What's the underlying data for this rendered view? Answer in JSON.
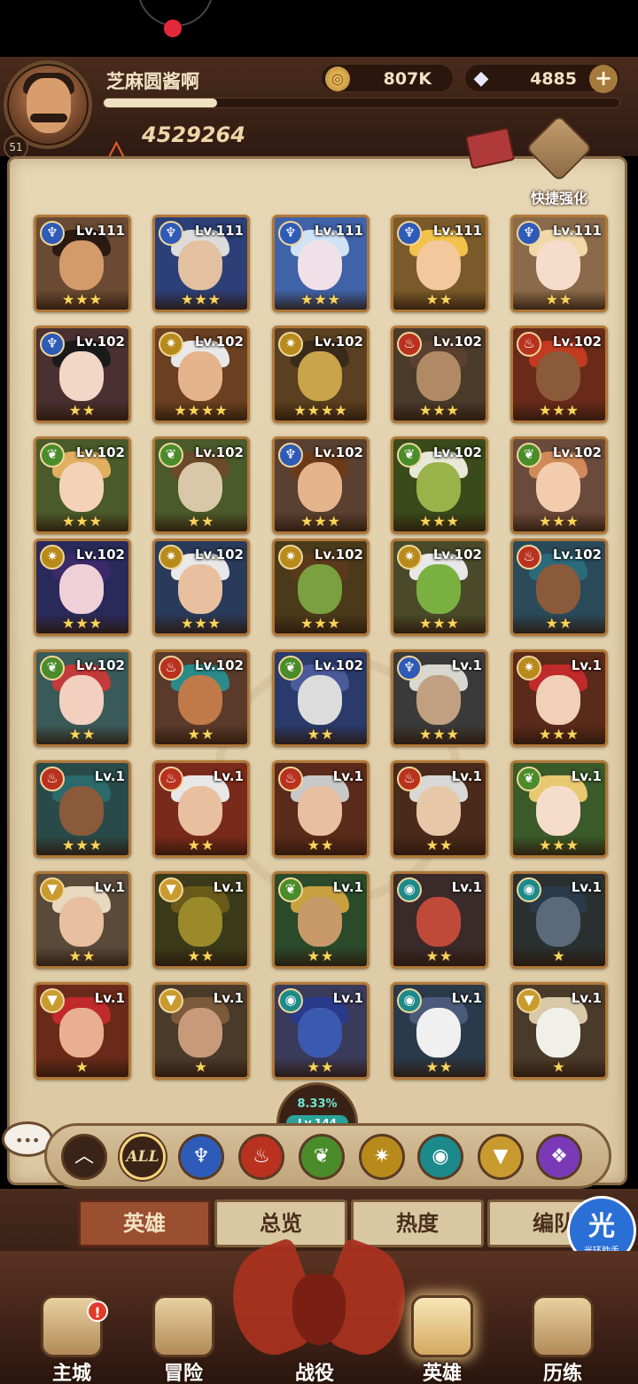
{
  "player": {
    "name": "芝麻圆酱啊",
    "level": "51",
    "power": "4529264",
    "exp_fraction": 0.22
  },
  "currency": {
    "gold": "807K",
    "gems": "4885",
    "plus_label": "+"
  },
  "quick_enhance": {
    "label": "快捷强化"
  },
  "colors": {
    "panel_bg": "#e7d7b5",
    "card_border": "#b07838",
    "star": "#f8d65a",
    "active_tab": "#9a4f30"
  },
  "heroes": [
    {
      "faction": "water",
      "level": "Lv.111",
      "stars": "★★★",
      "skin": "#d39a6a",
      "hair": "#2a1a12",
      "bg": "#6a4a32"
    },
    {
      "faction": "water",
      "level": "Lv.111",
      "stars": "★★★",
      "skin": "#e2c0a0",
      "hair": "#dcdcdc",
      "bg": "#2c3f77"
    },
    {
      "faction": "water",
      "level": "Lv.111",
      "stars": "★★★",
      "skin": "#f0e0e8",
      "hair": "#cfe2f6",
      "bg": "#3f62a8"
    },
    {
      "faction": "water",
      "level": "Lv.111",
      "stars": "★★",
      "skin": "#f3c89c",
      "hair": "#f2c24a",
      "bg": "#7a5a2a"
    },
    {
      "faction": "water",
      "level": "Lv.111",
      "stars": "★★",
      "skin": "#f6dccb",
      "hair": "#f0d8a8",
      "bg": "#8a6a4a"
    },
    {
      "faction": "water",
      "level": "Lv.102",
      "stars": "★★",
      "skin": "#f2d6c6",
      "hair": "#1a1a1a",
      "bg": "#4a3030"
    },
    {
      "faction": "light",
      "level": "Lv.102",
      "stars": "★★★★",
      "skin": "#e6b48c",
      "hair": "#e8e8e8",
      "bg": "#6a4020"
    },
    {
      "faction": "light",
      "level": "Lv.102",
      "stars": "★★★★",
      "skin": "#c9a44a",
      "hair": "#3a2a1a",
      "bg": "#5a4020"
    },
    {
      "faction": "fire",
      "level": "Lv.102",
      "stars": "★★★",
      "skin": "#b08a64",
      "hair": "#5a4030",
      "bg": "#4a3a2a"
    },
    {
      "faction": "fire",
      "level": "Lv.102",
      "stars": "★★★",
      "skin": "#8a5a3a",
      "hair": "#c23a1f",
      "bg": "#6a2a1a"
    },
    {
      "faction": "earth",
      "level": "Lv.102",
      "stars": "★★★",
      "skin": "#f3d2b8",
      "hair": "#e0b060",
      "bg": "#4a5a2a"
    },
    {
      "faction": "earth",
      "level": "Lv.102",
      "stars": "★★",
      "skin": "#d9c8a8",
      "hair": "#6a4a2a",
      "bg": "#4a5a2a"
    },
    {
      "faction": "water",
      "level": "Lv.102",
      "stars": "★★★",
      "skin": "#e6b48c",
      "hair": "#6a3a1a",
      "bg": "#5a4030"
    },
    {
      "faction": "earth",
      "level": "Lv.102",
      "stars": "★★★",
      "skin": "#9ab24a",
      "hair": "#e8e8d8",
      "bg": "#3a4a1a"
    },
    {
      "faction": "earth",
      "level": "Lv.102",
      "stars": "★★★",
      "skin": "#f3ccae",
      "hair": "#d08a5a",
      "bg": "#6a4a3a"
    },
    {
      "faction": "light",
      "level": "Lv.102",
      "stars": "★★★",
      "skin": "#f0d0d8",
      "hair": "#3a2a6a",
      "bg": "#2a2a5a"
    },
    {
      "faction": "light",
      "level": "Lv.102",
      "stars": "★★★",
      "skin": "#e8c0a0",
      "hair": "#e8e8e8",
      "bg": "#2a3a5a"
    },
    {
      "faction": "light",
      "level": "Lv.102",
      "stars": "★★★",
      "skin": "#7aa040",
      "hair": "#5a3a1a",
      "bg": "#4a3a1a"
    },
    {
      "faction": "light",
      "level": "Lv.102",
      "stars": "★★★",
      "skin": "#7ab040",
      "hair": "#e8e8e8",
      "bg": "#4a4a2a"
    },
    {
      "faction": "fire",
      "level": "Lv.102",
      "stars": "★★",
      "skin": "#8a5a3a",
      "hair": "#2a6a7a",
      "bg": "#2a4a5a"
    },
    {
      "faction": "earth",
      "level": "Lv.102",
      "stars": "★★",
      "skin": "#f2d0c0",
      "hair": "#c23a3a",
      "bg": "#3a5a5a"
    },
    {
      "faction": "fire",
      "level": "Lv.102",
      "stars": "★★",
      "skin": "#c07a4a",
      "hair": "#2a8a8a",
      "bg": "#5a3a2a"
    },
    {
      "faction": "earth",
      "level": "Lv.102",
      "stars": "★★",
      "skin": "#dcdcdc",
      "hair": "#4a5a9a",
      "bg": "#2a3a6a"
    },
    {
      "faction": "water",
      "level": "Lv.1",
      "stars": "★★★",
      "skin": "#c0a080",
      "hair": "#d8d8d0",
      "bg": "#3a3a3a"
    },
    {
      "faction": "light",
      "level": "Lv.1",
      "stars": "★★★",
      "skin": "#f0d0b8",
      "hair": "#c02a2a",
      "bg": "#5a2a1a"
    },
    {
      "faction": "fire",
      "level": "Lv.1",
      "stars": "★★★",
      "skin": "#8a5a3a",
      "hair": "#2a6a6a",
      "bg": "#2a4a4a"
    },
    {
      "faction": "fire",
      "level": "Lv.1",
      "stars": "★★",
      "skin": "#e8c0a0",
      "hair": "#e8e8e8",
      "bg": "#7a2a1a"
    },
    {
      "faction": "fire",
      "level": "Lv.1",
      "stars": "★★",
      "skin": "#e8c0a0",
      "hair": "#c8c8c8",
      "bg": "#5a2a1a"
    },
    {
      "faction": "fire",
      "level": "Lv.1",
      "stars": "★★",
      "skin": "#e6c8a8",
      "hair": "#d8d8d8",
      "bg": "#4a2a1a"
    },
    {
      "faction": "earth",
      "level": "Lv.1",
      "stars": "★★★",
      "skin": "#f6dccb",
      "hair": "#e8c870",
      "bg": "#3a5a2a"
    },
    {
      "faction": "gold",
      "level": "Lv.1",
      "stars": "★★",
      "skin": "#e8c0a0",
      "hair": "#e8d8c0",
      "bg": "#5a4a3a"
    },
    {
      "faction": "gold",
      "level": "Lv.1",
      "stars": "★★",
      "skin": "#9a8a2a",
      "hair": "#6a5a1a",
      "bg": "#3a3a1a"
    },
    {
      "faction": "earth",
      "level": "Lv.1",
      "stars": "★★",
      "skin": "#c89a6a",
      "hair": "#c8a040",
      "bg": "#2a4a2a"
    },
    {
      "faction": "beast",
      "level": "Lv.1",
      "stars": "★★",
      "skin": "#c04a3a",
      "hair": "#3a2a2a",
      "bg": "#3a2a2a"
    },
    {
      "faction": "beast",
      "level": "Lv.1",
      "stars": "★",
      "skin": "#5a6a7a",
      "hair": "#2a3a4a",
      "bg": "#2a3030"
    },
    {
      "faction": "gold",
      "level": "Lv.1",
      "stars": "★",
      "skin": "#e8b090",
      "hair": "#c02a2a",
      "bg": "#6a2a1a"
    },
    {
      "faction": "gold",
      "level": "Lv.1",
      "stars": "★",
      "skin": "#c89a7a",
      "hair": "#7a5a3a",
      "bg": "#4a3a2a"
    },
    {
      "faction": "beast",
      "level": "Lv.1",
      "stars": "★★",
      "skin": "#3a5ab0",
      "hair": "#2a3a8a",
      "bg": "#3a3a5a"
    },
    {
      "faction": "beast",
      "level": "Lv.1",
      "stars": "★★",
      "skin": "#f0f0f0",
      "hair": "#4a5a7a",
      "bg": "#2a3a4a"
    },
    {
      "faction": "gold",
      "level": "Lv.1",
      "stars": "★",
      "skin": "#f0f0e8",
      "hair": "#d8c8a8",
      "bg": "#4a3a2a"
    }
  ],
  "faction_icons": {
    "water": "♆",
    "light": "✷",
    "fire": "♨",
    "earth": "❦",
    "beast": "◉",
    "gold": "▼"
  },
  "collection_progress": {
    "percent": "8.33%",
    "level": "Lv.144"
  },
  "filters": [
    {
      "id": "collapse",
      "icon": "︿",
      "color": "#3a2418"
    },
    {
      "id": "all",
      "label": "ALL",
      "color": "#3a2418"
    },
    {
      "id": "water",
      "icon": "♆",
      "color": "#2f5bb8"
    },
    {
      "id": "fire",
      "icon": "♨",
      "color": "#b8321f"
    },
    {
      "id": "earth",
      "icon": "❦",
      "color": "#4a8c2a"
    },
    {
      "id": "light",
      "icon": "✷",
      "color": "#b88a1c"
    },
    {
      "id": "beast",
      "icon": "◉",
      "color": "#1c8a8a"
    },
    {
      "id": "gold",
      "icon": "▼",
      "color": "#c99a2e"
    },
    {
      "id": "void",
      "icon": "❖",
      "color": "#7a3ab8"
    }
  ],
  "tabs": [
    {
      "label": "英雄",
      "active": true
    },
    {
      "label": "总览",
      "active": false
    },
    {
      "label": "热度",
      "active": false
    },
    {
      "label": "编队",
      "active": false
    }
  ],
  "helper": {
    "char": "光",
    "label": "光环助手"
  },
  "bottom_nav": [
    {
      "label": "主城",
      "alert": "!"
    },
    {
      "label": "冒险"
    },
    {
      "label": "战役"
    },
    {
      "label": "英雄",
      "active": true
    },
    {
      "label": "历练"
    }
  ]
}
